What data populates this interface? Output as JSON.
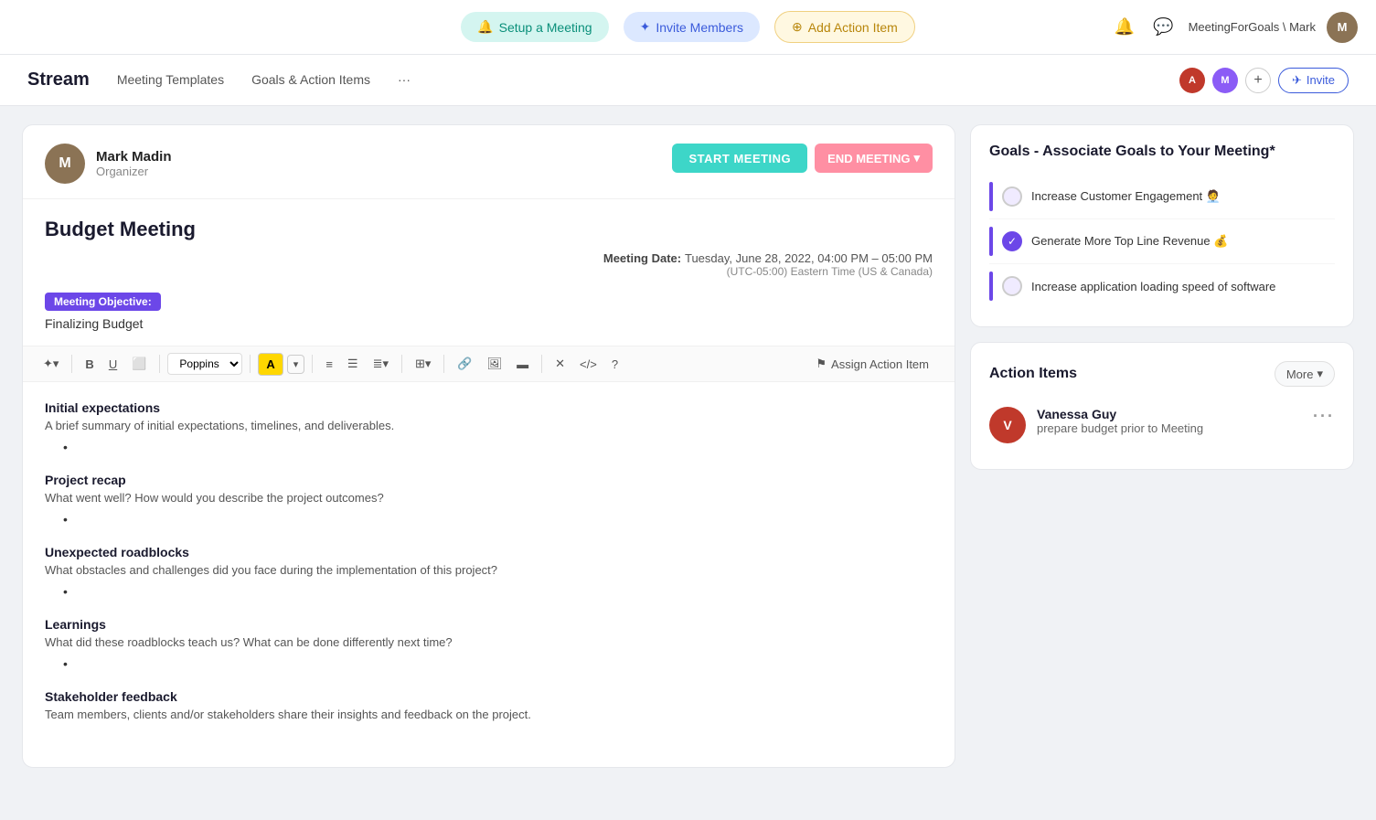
{
  "topnav": {
    "setup_label": "Setup a Meeting",
    "invite_label": "Invite Members",
    "action_label": "Add Action Item",
    "user_label": "MeetingForGoals \\ Mark",
    "setup_icon": "🔔",
    "invite_icon": "✦",
    "action_icon": "+"
  },
  "stream_header": {
    "title": "Stream",
    "nav_items": [
      {
        "label": "Meeting Templates",
        "active": false
      },
      {
        "label": "Goals & Action Items",
        "active": false
      }
    ],
    "more_label": "···",
    "invite_label": "Invite",
    "avatars": [
      {
        "initials": "A",
        "color": "#c0392b"
      },
      {
        "initials": "M",
        "color": "#8b5cf6"
      }
    ]
  },
  "meeting": {
    "organizer_name": "Mark Madin",
    "organizer_role": "Organizer",
    "organizer_initials": "M",
    "start_meeting": "START MEETING",
    "end_meeting": "END MEETING",
    "title": "Budget Meeting",
    "date_label": "Meeting Date:",
    "date_value": "Tuesday, June 28, 2022, 04:00 PM – 05:00 PM",
    "timezone": "(UTC-05:00) Eastern Time (US & Canada)",
    "objective_tag": "Meeting Objective:",
    "objective_text": "Finalizing Budget"
  },
  "toolbar": {
    "assign_label": "Assign Action Item",
    "font_name": "Poppins",
    "buttons": [
      "✦",
      "B",
      "U",
      "⬜",
      "A",
      "≡",
      "☰",
      "≣",
      "⊞",
      "🔗",
      "🖼",
      "▬",
      "✕",
      "</>",
      "?"
    ]
  },
  "editor": {
    "sections": [
      {
        "title": "Initial expectations",
        "desc": "A brief summary of initial expectations, timelines, and deliverables."
      },
      {
        "title": "Project recap",
        "desc": "What went well? How would you describe the project outcomes?"
      },
      {
        "title": "Unexpected roadblocks",
        "desc": "What obstacles and challenges did you face during the implementation of this project?"
      },
      {
        "title": "Learnings",
        "desc": "What did these roadblocks teach us? What can be done differently next time?"
      },
      {
        "title": "Stakeholder feedback",
        "desc": "Team members, clients and/or stakeholders share their insights and feedback on the project."
      }
    ]
  },
  "goals": {
    "card_title": "Goals - Associate Goals to Your Meeting*",
    "items": [
      {
        "text": "Increase Customer Engagement 🧑‍💼",
        "checked": false
      },
      {
        "text": "Generate More Top Line Revenue 💰",
        "checked": true
      },
      {
        "text": "Increase application loading speed of software",
        "checked": false
      }
    ]
  },
  "action_items": {
    "card_title": "Action Items",
    "more_label": "More",
    "items": [
      {
        "name": "Vanessa Guy",
        "initials": "V",
        "color": "#c0392b",
        "desc": "prepare budget prior to Meeting"
      }
    ]
  }
}
